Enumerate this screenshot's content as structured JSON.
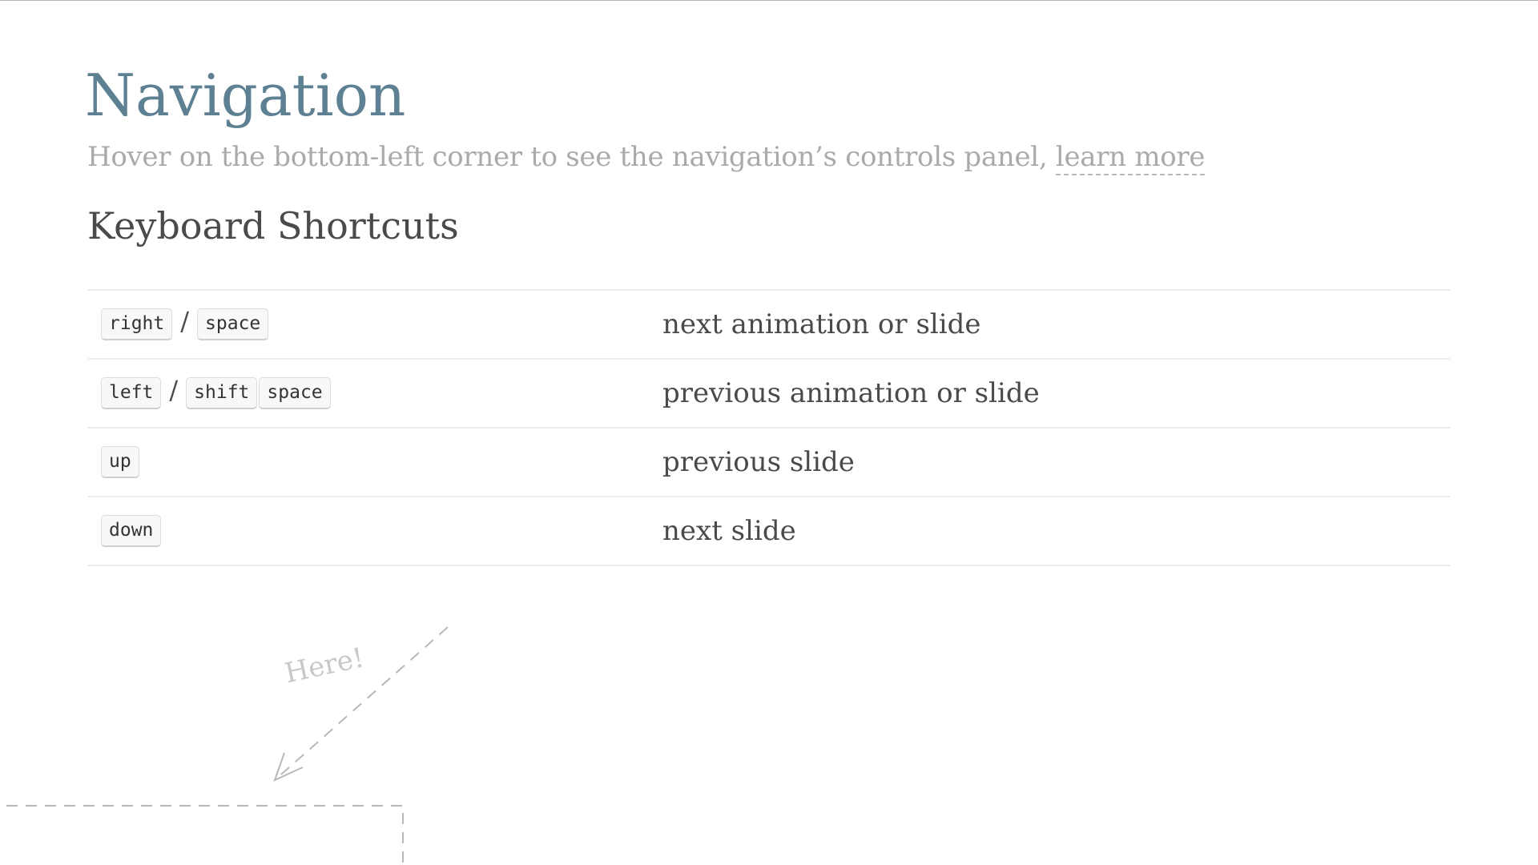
{
  "page": {
    "title": "Navigation",
    "subtitle_text": "Hover on the bottom-left corner to see the navigation’s controls panel, ",
    "subtitle_link": "learn more",
    "section_title": "Keyboard Shortcuts"
  },
  "shortcuts": [
    {
      "keys": [
        "right",
        "space"
      ],
      "separator": "/",
      "description": "next animation or slide"
    },
    {
      "keys": [
        "left",
        "shift",
        "space"
      ],
      "separator": "/",
      "description": "previous animation or slide"
    },
    {
      "keys": [
        "up"
      ],
      "description": "previous slide"
    },
    {
      "keys": [
        "down"
      ],
      "description": "next slide"
    }
  ],
  "hint": {
    "label": "Here!"
  },
  "colors": {
    "title": "#5d8092",
    "text": "#4a4a4a",
    "muted": "#aaaaaa",
    "hint": "#c8c8c8",
    "rule": "#ececec"
  }
}
